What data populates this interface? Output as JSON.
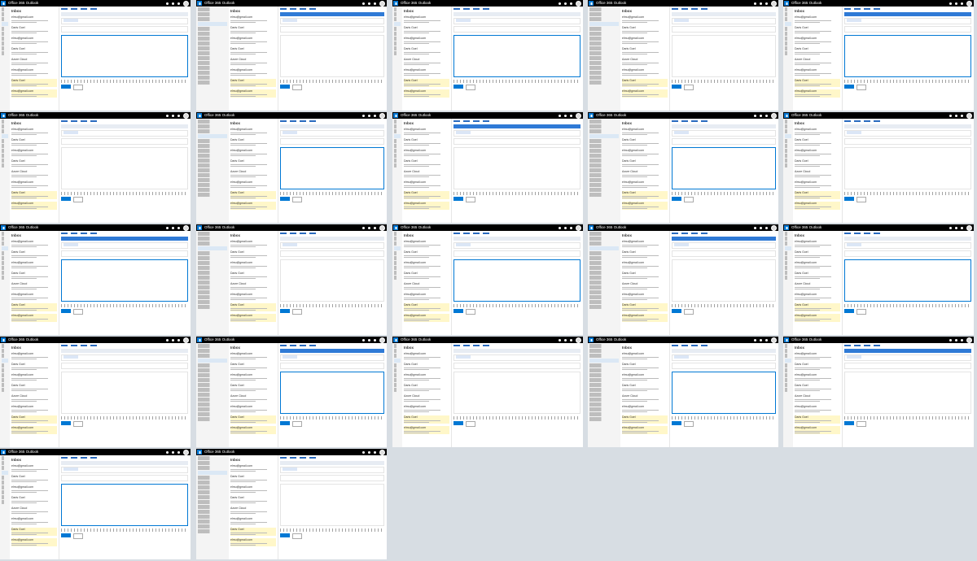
{
  "window": {
    "product": "Office 365",
    "app": "Outlook"
  },
  "inbox": {
    "title": "Inbox",
    "items": [
      {
        "from": "elmu@gmail.com"
      },
      {
        "from": "Daris Goel"
      },
      {
        "from": "elmu@gmail.com"
      },
      {
        "from": "Daris Goel"
      },
      {
        "from": "Azure Cloud"
      }
    ]
  },
  "tiles": [
    {
      "variant": "list-compose"
    },
    {
      "variant": "wide-folders"
    },
    {
      "variant": "list-compose"
    },
    {
      "variant": "wide-folders"
    },
    {
      "variant": "list-compose"
    },
    {
      "variant": "list-compose"
    },
    {
      "variant": "wide-folders"
    },
    {
      "variant": "list-compose"
    },
    {
      "variant": "wide-folders"
    },
    {
      "variant": "list-compose"
    },
    {
      "variant": "list-compose"
    },
    {
      "variant": "wide-folders"
    },
    {
      "variant": "list-compose"
    },
    {
      "variant": "wide-folders"
    },
    {
      "variant": "list-compose"
    },
    {
      "variant": "list-compose"
    },
    {
      "variant": "wide-folders"
    },
    {
      "variant": "list-compose"
    },
    {
      "variant": "wide-folders"
    },
    {
      "variant": "list-compose"
    },
    {
      "variant": "list-compose"
    },
    {
      "variant": "wide-folders"
    }
  ]
}
